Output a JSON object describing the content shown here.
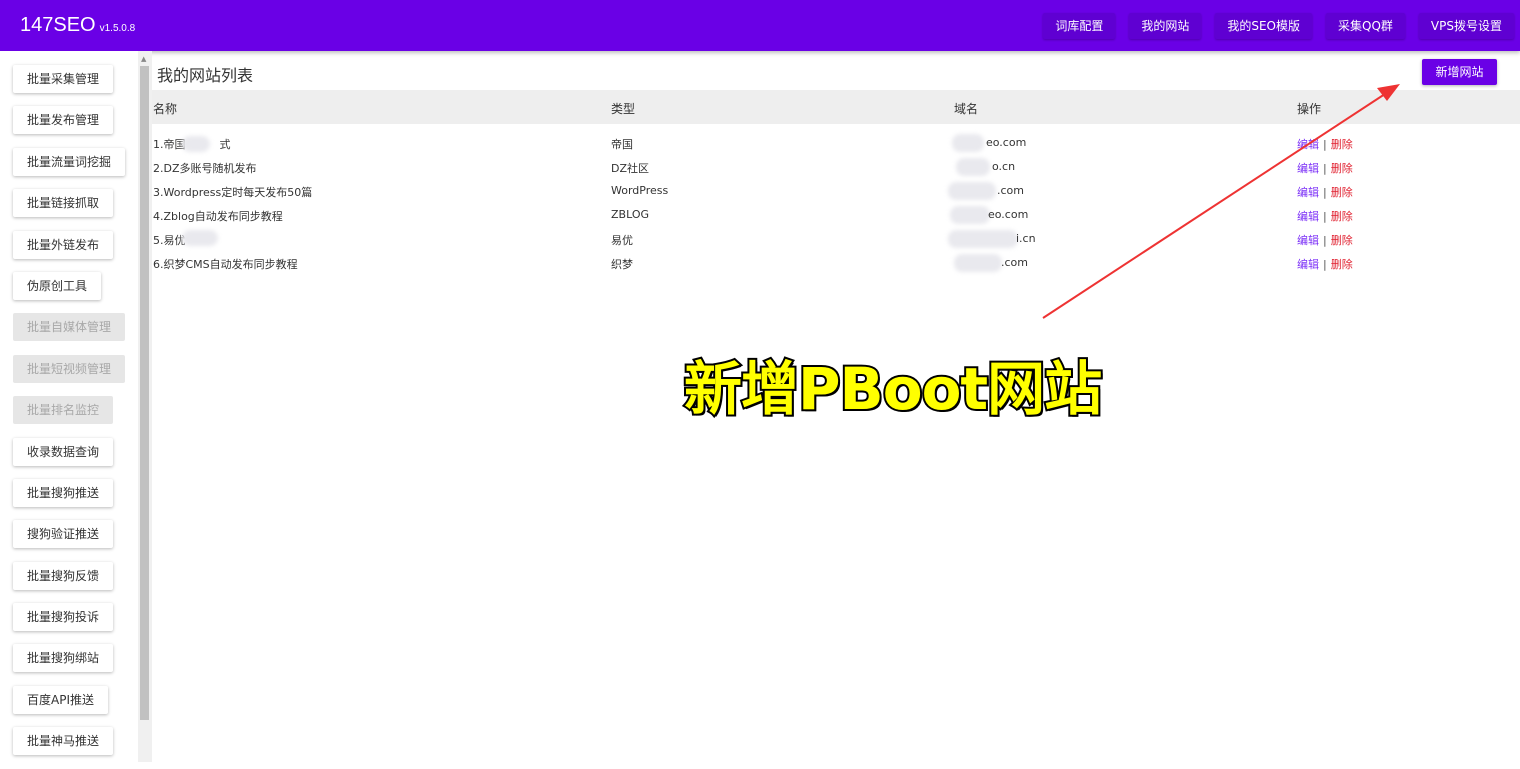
{
  "header": {
    "brand": "147SEO",
    "version": "v1.5.0.8",
    "nav": [
      "词库配置",
      "我的网站",
      "我的SEO模版",
      "采集QQ群",
      "VPS拨号设置"
    ]
  },
  "sidebar": {
    "items": [
      {
        "label": "批量采集管理",
        "disabled": false
      },
      {
        "label": "批量发布管理",
        "disabled": false
      },
      {
        "label": "批量流量词挖掘",
        "disabled": false
      },
      {
        "label": "批量链接抓取",
        "disabled": false
      },
      {
        "label": "批量外链发布",
        "disabled": false
      },
      {
        "label": "伪原创工具",
        "disabled": false
      },
      {
        "label": "批量自媒体管理",
        "disabled": true
      },
      {
        "label": "批量短视频管理",
        "disabled": true
      },
      {
        "label": "批量排名监控",
        "disabled": true
      },
      {
        "label": "收录数据查询",
        "disabled": false
      },
      {
        "label": "批量搜狗推送",
        "disabled": false
      },
      {
        "label": "搜狗验证推送",
        "disabled": false
      },
      {
        "label": "批量搜狗反馈",
        "disabled": false
      },
      {
        "label": "批量搜狗投诉",
        "disabled": false
      },
      {
        "label": "批量搜狗绑站",
        "disabled": false
      },
      {
        "label": "百度API推送",
        "disabled": false
      },
      {
        "label": "批量神马推送",
        "disabled": false
      }
    ]
  },
  "main": {
    "title": "我的网站列表",
    "add_button": "新增网站",
    "columns": [
      "名称",
      "类型",
      "域名",
      "操作"
    ],
    "rows": [
      {
        "name": "1.帝国",
        "name_tail": "式",
        "type": "帝国",
        "domain": "eo.com"
      },
      {
        "name": "2.DZ多账号随机发布",
        "name_tail": "",
        "type": "DZ社区",
        "domain": "o.cn"
      },
      {
        "name": "3.Wordpress定时每天发布50篇",
        "name_tail": "",
        "type": "WordPress",
        "domain": ".com"
      },
      {
        "name": "4.Zblog自动发布同步教程",
        "name_tail": "",
        "type": "ZBLOG",
        "domain": "eo.com"
      },
      {
        "name": "5.易优",
        "name_tail": "",
        "type": "易优",
        "domain": "i.cn"
      },
      {
        "name": "6.织梦CMS自动发布同步教程",
        "name_tail": "",
        "type": "织梦",
        "domain": ".com"
      }
    ],
    "edit_label": "编辑",
    "separator": "|",
    "delete_label": "删除"
  },
  "annotation": {
    "text": "新增PBoot网站",
    "color": "#ffff00",
    "arrow_color": "#ee3333"
  },
  "colors": {
    "accent": "#6a00e6",
    "delete": "#e0202f",
    "edit": "#7b2ff7"
  }
}
